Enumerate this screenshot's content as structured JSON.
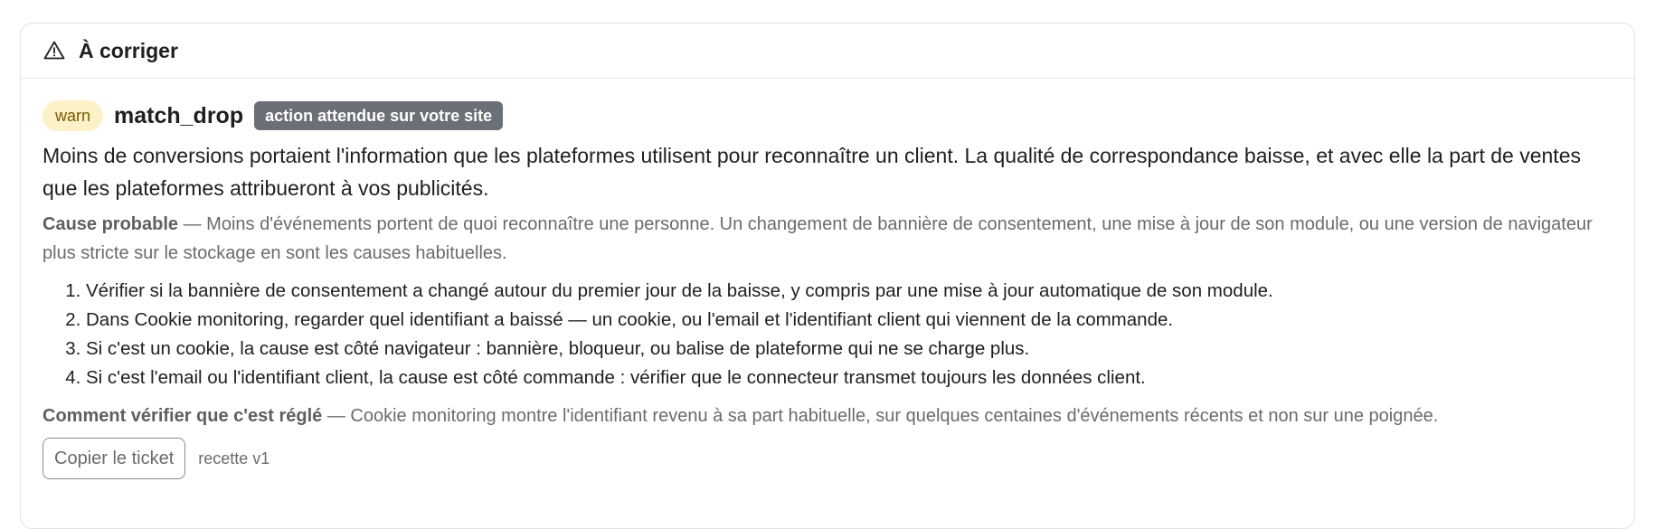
{
  "card": {
    "title": "À corriger",
    "icon": "warning-triangle-icon"
  },
  "issue": {
    "severity": "warn",
    "code": "match_drop",
    "action_badge": "action attendue sur votre site",
    "description": "Moins de conversions portaient l'information que les plateformes utilisent pour reconnaître un client. La qualité de correspondance baisse, et avec elle la part de ventes que les plateformes attribueront à vos publicités.",
    "cause_label": "Cause probable",
    "cause_text": " — Moins d'événements portent de quoi reconnaître une personne. Un changement de bannière de consentement, une mise à jour de son module, ou une version de navigateur plus stricte sur le stockage en sont les causes habituelles.",
    "steps": [
      "Vérifier si la bannière de consentement a changé autour du premier jour de la baisse, y compris par une mise à jour automatique de son module.",
      "Dans Cookie monitoring, regarder quel identifiant a baissé — un cookie, ou l'email et l'identifiant client qui viennent de la commande.",
      "Si c'est un cookie, la cause est côté navigateur : bannière, bloqueur, ou balise de plateforme qui ne se charge plus.",
      "Si c'est l'email ou l'identifiant client, la cause est côté commande : vérifier que le connecteur transmet toujours les données client."
    ],
    "verify_label": "Comment vérifier que c'est réglé",
    "verify_text": " — Cookie monitoring montre l'identifiant revenu à sa part habituelle, sur quelques centaines d'événements récents et non sur une poignée.",
    "copy_button": "Copier le ticket",
    "recipe": "recette v1"
  },
  "colors": {
    "warn_bg": "#fdf1c8",
    "warn_text": "#7a5a00",
    "action_bg": "#6b6f76"
  }
}
